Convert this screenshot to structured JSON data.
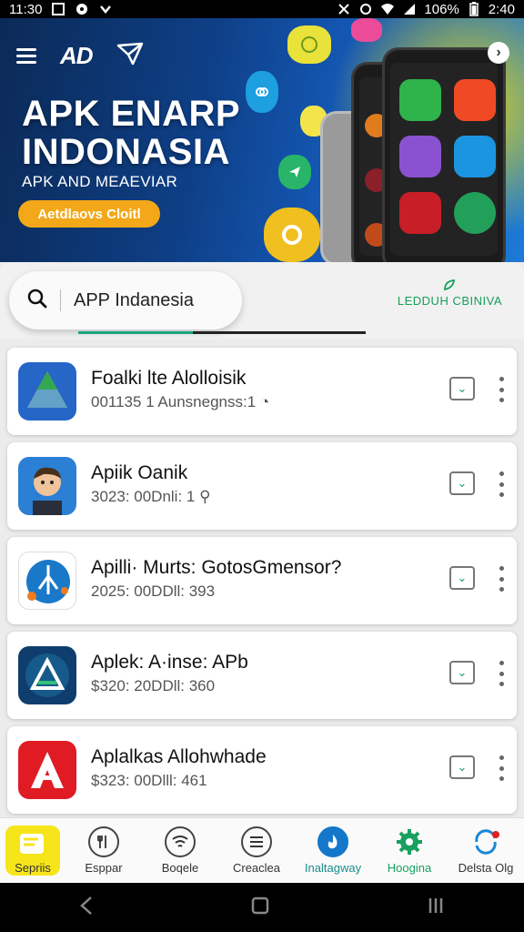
{
  "status_bar": {
    "time_left": "11:30",
    "battery": "106%",
    "time_right": "2:40"
  },
  "hero": {
    "title_line1": "APK ENARP",
    "title_line2": "INDONASIA",
    "subtitle": "APK AND MEAEVIAR",
    "button_label": "Aetdlaovs Cloitl",
    "logo": "AD"
  },
  "search": {
    "value": "APP Indanesia",
    "right_label": "LEDDUH CBINIVA",
    "progress": 0.4
  },
  "apps": [
    {
      "name": "Foalki lte Alolloisik",
      "meta": "001135 1 Aunsnegnss:1",
      "icon": "drive-triangle-icon"
    },
    {
      "name": "Apiik Oanik",
      "meta": "3023: 00Dnli: 1",
      "icon": "cartoon-avatar-icon"
    },
    {
      "name": "Apilli· Murts: GotosGmensor?",
      "meta": "2025: 00DDll: 393",
      "icon": "pen-tool-icon"
    },
    {
      "name": "Aplek: A·inse: APb",
      "meta": "$320: 20DDll: 360",
      "icon": "triangle-logo-icon"
    },
    {
      "name": "Aplalkas Allohwhade",
      "meta": "$323: 00Dlll: 461",
      "icon": "red-a-icon"
    }
  ],
  "bottom_nav": [
    {
      "label": "Sepriis",
      "icon": "yellow-app-icon"
    },
    {
      "label": "Esppar",
      "icon": "utensils-icon"
    },
    {
      "label": "Boqele",
      "icon": "wifi-icon"
    },
    {
      "label": "Creaclea",
      "icon": "list-icon"
    },
    {
      "label": "Inaltagway",
      "icon": "flame-icon"
    },
    {
      "label": "Hoogina",
      "icon": "gear-icon"
    },
    {
      "label": "Delsta Olg",
      "icon": "refresh-icon"
    }
  ],
  "colors": {
    "accent_green": "#17a060",
    "hero_button": "#f2a818",
    "highlight_yellow": "#f6e51a"
  }
}
